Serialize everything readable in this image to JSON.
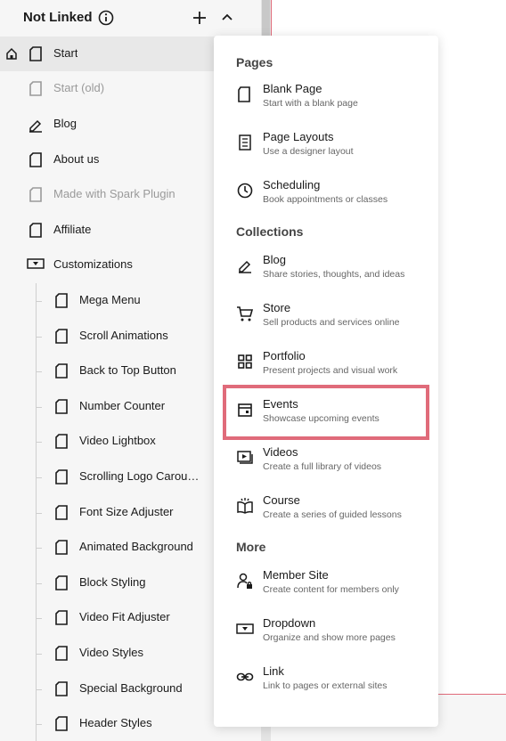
{
  "header": {
    "title": "Not Linked"
  },
  "nav": {
    "start": "Start",
    "start_old": "Start (old)",
    "blog": "Blog",
    "about": "About us",
    "spark": "Made with Spark Plugin",
    "affiliate": "Affiliate",
    "customizations": "Customizations",
    "children": [
      "Mega Menu",
      "Scroll Animations",
      "Back to Top Button",
      "Number Counter",
      "Video Lightbox",
      "Scrolling Logo Carousel",
      "Font Size Adjuster",
      "Animated Background",
      "Block Styling",
      "Video Fit Adjuster",
      "Video Styles",
      "Special Background",
      "Header Styles"
    ]
  },
  "menu": {
    "pages_title": "Pages",
    "collections_title": "Collections",
    "more_title": "More",
    "pages": [
      {
        "title": "Blank Page",
        "desc": "Start with a blank page",
        "icon": "page-icon"
      },
      {
        "title": "Page Layouts",
        "desc": "Use a designer layout",
        "icon": "layout-icon"
      },
      {
        "title": "Scheduling",
        "desc": "Book appointments or classes",
        "icon": "clock-icon"
      }
    ],
    "collections": [
      {
        "title": "Blog",
        "desc": "Share stories, thoughts, and ideas",
        "icon": "pen-icon"
      },
      {
        "title": "Store",
        "desc": "Sell products and services online",
        "icon": "cart-icon"
      },
      {
        "title": "Portfolio",
        "desc": "Present projects and visual work",
        "icon": "grid-icon"
      },
      {
        "title": "Events",
        "desc": "Showcase upcoming events",
        "icon": "calendar-icon"
      },
      {
        "title": "Videos",
        "desc": "Create a full library of videos",
        "icon": "video-icon"
      },
      {
        "title": "Course",
        "desc": "Create a series of guided lessons",
        "icon": "book-icon"
      }
    ],
    "more": [
      {
        "title": "Member Site",
        "desc": "Create content for members only",
        "icon": "member-icon"
      },
      {
        "title": "Dropdown",
        "desc": "Organize and show more pages",
        "icon": "dropdown-icon"
      },
      {
        "title": "Link",
        "desc": "Link to pages or external sites",
        "icon": "link-icon"
      }
    ]
  },
  "colors": {
    "highlight": "#e06b7a",
    "sidebar_bg": "#f6f6f6",
    "active_bg": "#e8e8e8"
  }
}
